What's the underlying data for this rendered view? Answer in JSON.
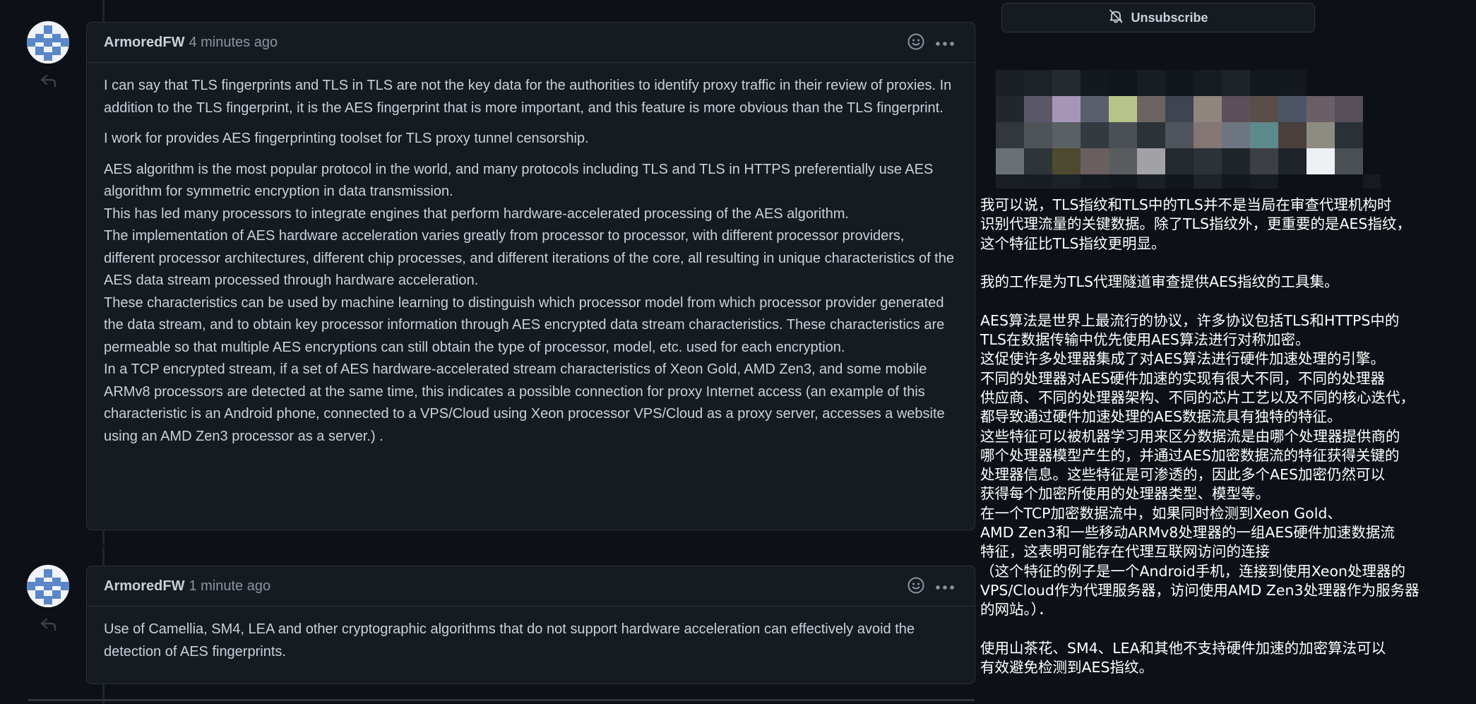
{
  "notifications": {
    "unsubscribe_label": "Unsubscribe"
  },
  "comments": [
    {
      "author": "ArmoredFW",
      "timestamp": "4 minutes ago",
      "paragraphs": [
        "I can say that TLS fingerprints and TLS in TLS are not the key data for the authorities to identify proxy traffic in their review of proxies. In addition to the TLS fingerprint, it is the AES fingerprint that is more important, and this feature is more obvious than the TLS fingerprint.",
        "I work for provides AES fingerprinting toolset for TLS proxy tunnel censorship.",
        "AES algorithm is the most popular protocol in the world, and many protocols including TLS and TLS in HTTPS preferentially use AES algorithm for symmetric encryption in data transmission.",
        "This has led many processors to integrate engines that perform hardware-accelerated processing of the AES algorithm.",
        "The implementation of AES hardware acceleration varies greatly from processor to processor, with different processor providers, different processor architectures, different chip processes, and different iterations of the core, all resulting in unique characteristics of the AES data stream processed through hardware acceleration.",
        "These characteristics can be used by machine learning to distinguish which processor model from which processor provider generated the data stream, and to obtain key processor information through AES encrypted data stream characteristics. These characteristics are permeable so that multiple AES encryptions can still obtain the type of processor, model, etc. used for each encryption.",
        "In a TCP encrypted stream, if a set of AES hardware-accelerated stream characteristics of Xeon Gold, AMD Zen3, and some mobile ARMv8 processors are detected at the same time, this indicates a possible connection for proxy Internet access (an example of this characteristic is an Android phone, connected to a VPS/Cloud using Xeon processor VPS/Cloud as a proxy server, accesses a website using an AMD Zen3 processor as a server.) ."
      ]
    },
    {
      "author": "ArmoredFW",
      "timestamp": "1 minute ago",
      "paragraphs": [
        "Use of Camellia, SM4, LEA and other cryptographic algorithms that do not support hardware acceleration can effectively avoid the detection of AES fingerprints."
      ]
    }
  ],
  "translation": {
    "lines": [
      "我可以说，TLS指纹和TLS中的TLS并不是当局在审查代理机构时",
      "识别代理流量的关键数据。除了TLS指纹外，更重要的是AES指纹，",
      "这个特征比TLS指纹更明显。",
      "",
      "我的工作是为TLS代理隧道审查提供AES指纹的工具集。",
      "",
      "AES算法是世界上最流行的协议，许多协议包括TLS和HTTPS中的",
      "TLS在数据传输中优先使用AES算法进行对称加密。",
      "这促使许多处理器集成了对AES算法进行硬件加速处理的引擎。",
      "不同的处理器对AES硬件加速的实现有很大不同，不同的处理器",
      "供应商、不同的处理器架构、不同的芯片工艺以及不同的核心迭代，",
      "都导致通过硬件加速处理的AES数据流具有独特的特征。",
      "这些特征可以被机器学习用来区分数据流是由哪个处理器提供商的",
      "哪个处理器模型产生的，并通过AES加密数据流的特征获得关键的",
      "处理器信息。这些特征是可渗透的，因此多个AES加密仍然可以",
      "获得每个加密所使用的处理器类型、模型等。",
      "在一个TCP加密数据流中，如果同时检测到Xeon Gold、",
      "AMD Zen3和一些移动ARMv8处理器的一组AES硬件加速数据流",
      "特征，这表明可能存在代理互联网访问的连接",
      "（这个特征的例子是一个Android手机，连接到使用Xeon处理器的",
      "VPS/Cloud作为代理服务器，访问使用AMD Zen3处理器作为服务器",
      "的网站。）．",
      "",
      "使用山茶花、SM4、LEA和其他不支持硬件加速的加密算法可以",
      "有效避免检测到AES指纹。"
    ]
  },
  "colors": {
    "background": "#0d1117",
    "card": "#161b22",
    "border": "#2b3139",
    "text": "#c9d1d9",
    "muted": "#8b949e",
    "translation_text": "#ffffff"
  },
  "icons": {
    "avatar": "identicon-avatar",
    "reply": "reply-arrow-icon",
    "reaction": "smiley-icon",
    "more": "kebab-horizontal-icon",
    "unsubscribe": "bell-slash-icon"
  }
}
